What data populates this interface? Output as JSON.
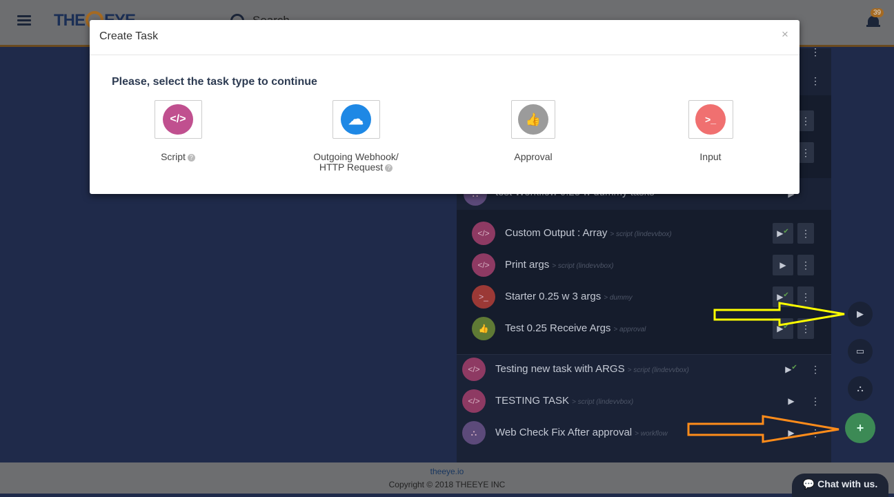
{
  "header": {
    "logo_text": "THE",
    "logo_text2": "EYE",
    "search_placeholder": "Search",
    "notification_count": "39"
  },
  "tasks": {
    "top_partial": "test Workflow 0.25 w dummy tasks",
    "group_rows": [
      {
        "name": "Custom Output : Array",
        "meta": "> script (lindevvbox)",
        "icon": "code",
        "color": "#8e3a63",
        "checked": true
      },
      {
        "name": "Print args",
        "meta": "> script (lindevvbox)",
        "icon": "code",
        "color": "#8e3a63",
        "checked": false
      },
      {
        "name": "Starter 0.25 w 3 args",
        "meta": "> dummy",
        "icon": "terminal",
        "color": "#9b3936",
        "checked": true
      },
      {
        "name": "Test 0.25 Receive Args",
        "meta": "> approval",
        "icon": "thumbs-up",
        "color": "#5f7a35",
        "checked": true
      }
    ],
    "rows": [
      {
        "name": "Testing new task with ARGS",
        "meta": "> script (lindevvbox)",
        "icon": "code",
        "color": "#8e3a63",
        "checked": true
      },
      {
        "name": "TESTING TASK",
        "meta": "> script (lindevvbox)",
        "icon": "code",
        "color": "#8e3a63",
        "checked": false
      },
      {
        "name": "Web Check Fix After approval",
        "meta": "> workflow",
        "icon": "sitemap",
        "color": "#5c4a7a",
        "checked": false
      }
    ]
  },
  "modal": {
    "title": "Create Task",
    "close": "×",
    "prompt": "Please, select the task type to continue",
    "options": [
      {
        "label": "Script",
        "help": "?",
        "icon": "code-icon",
        "color": "#c0508f",
        "glyph": "</>"
      },
      {
        "label": "Outgoing Webhook/",
        "label2": "HTTP Request",
        "help": "?",
        "icon": "cloud-icon",
        "color": "#1e88e5",
        "glyph": "☁"
      },
      {
        "label": "Approval",
        "icon": "thumbs-up-icon",
        "color": "#9b9b9b",
        "glyph": "👍"
      },
      {
        "label": "Input",
        "icon": "terminal-icon",
        "color": "#f07070",
        "glyph": ">_"
      }
    ]
  },
  "fabs": {
    "play": "▶",
    "monitor": "▭",
    "workflow": "⛬",
    "add": "+"
  },
  "footer": {
    "link": "theeye.io",
    "copyright": "Copyright © 2018 THEEYE INC",
    "chat": "Chat with us."
  },
  "colors": {
    "arrow_yellow": "#ffff00",
    "arrow_orange": "#ff8c1a"
  }
}
